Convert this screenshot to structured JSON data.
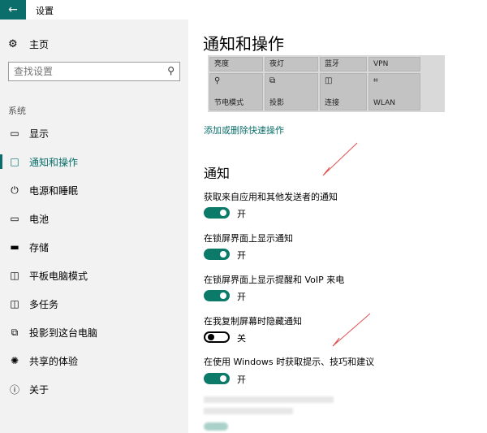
{
  "window": {
    "title": "设置",
    "back_icon": "back-arrow-icon"
  },
  "sidebar": {
    "home_label": "主页",
    "search_placeholder": "查找设置",
    "section_label": "系统",
    "items": [
      {
        "label": "显示",
        "icon": "monitor-icon",
        "active": false
      },
      {
        "label": "通知和操作",
        "icon": "message-icon",
        "active": true
      },
      {
        "label": "电源和睡眠",
        "icon": "power-icon",
        "active": false
      },
      {
        "label": "电池",
        "icon": "battery-icon",
        "active": false
      },
      {
        "label": "存储",
        "icon": "storage-icon",
        "active": false
      },
      {
        "label": "平板电脑模式",
        "icon": "tablet-mode-icon",
        "active": false
      },
      {
        "label": "多任务",
        "icon": "multitask-icon",
        "active": false
      },
      {
        "label": "投影到这台电脑",
        "icon": "project-to-pc-icon",
        "active": false
      },
      {
        "label": "共享的体验",
        "icon": "shared-experience-icon",
        "active": false
      },
      {
        "label": "关于",
        "icon": "info-icon",
        "active": false
      }
    ]
  },
  "main": {
    "title": "通知和操作",
    "quick_actions": [
      {
        "label": "亮度",
        "icon": ""
      },
      {
        "label": "夜灯",
        "icon": ""
      },
      {
        "label": "蓝牙",
        "icon": ""
      },
      {
        "label": "VPN",
        "icon": ""
      },
      {
        "label": "节电模式",
        "icon": "battery-saver-icon"
      },
      {
        "label": "投影",
        "icon": "project-icon"
      },
      {
        "label": "连接",
        "icon": "connect-icon"
      },
      {
        "label": "WLAN",
        "icon": "wifi-icon"
      }
    ],
    "edit_link": "添加或删除快速操作",
    "notifications_heading": "通知",
    "settings": [
      {
        "label": "获取来自应用和其他发送者的通知",
        "state": "开",
        "on": true
      },
      {
        "label": "在锁屏界面上显示通知",
        "state": "开",
        "on": true
      },
      {
        "label": "在锁屏界面上显示提醒和 VoIP 来电",
        "state": "开",
        "on": true
      },
      {
        "label": "在我复制屏幕时隐藏通知",
        "state": "关",
        "on": false
      },
      {
        "label": "在使用 Windows 时获取提示、技巧和建议",
        "state": "开",
        "on": true
      }
    ]
  },
  "colors": {
    "accent": "#0b6e6a",
    "sidebar_bg": "#f2f2f2",
    "tile_bg": "#c3c3c3",
    "annotation": "#e05050"
  }
}
